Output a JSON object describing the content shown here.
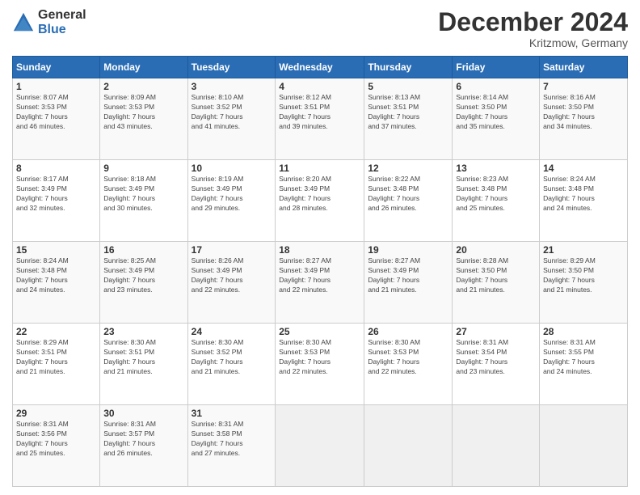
{
  "logo": {
    "general": "General",
    "blue": "Blue"
  },
  "header": {
    "title": "December 2024",
    "subtitle": "Kritzmow, Germany"
  },
  "days_of_week": [
    "Sunday",
    "Monday",
    "Tuesday",
    "Wednesday",
    "Thursday",
    "Friday",
    "Saturday"
  ],
  "weeks": [
    [
      {
        "day": "1",
        "sunrise": "8:07 AM",
        "sunset": "3:53 PM",
        "daylight": "7 hours and 46 minutes."
      },
      {
        "day": "2",
        "sunrise": "8:09 AM",
        "sunset": "3:53 PM",
        "daylight": "7 hours and 43 minutes."
      },
      {
        "day": "3",
        "sunrise": "8:10 AM",
        "sunset": "3:52 PM",
        "daylight": "7 hours and 41 minutes."
      },
      {
        "day": "4",
        "sunrise": "8:12 AM",
        "sunset": "3:51 PM",
        "daylight": "7 hours and 39 minutes."
      },
      {
        "day": "5",
        "sunrise": "8:13 AM",
        "sunset": "3:51 PM",
        "daylight": "7 hours and 37 minutes."
      },
      {
        "day": "6",
        "sunrise": "8:14 AM",
        "sunset": "3:50 PM",
        "daylight": "7 hours and 35 minutes."
      },
      {
        "day": "7",
        "sunrise": "8:16 AM",
        "sunset": "3:50 PM",
        "daylight": "7 hours and 34 minutes."
      }
    ],
    [
      {
        "day": "8",
        "sunrise": "8:17 AM",
        "sunset": "3:49 PM",
        "daylight": "7 hours and 32 minutes."
      },
      {
        "day": "9",
        "sunrise": "8:18 AM",
        "sunset": "3:49 PM",
        "daylight": "7 hours and 30 minutes."
      },
      {
        "day": "10",
        "sunrise": "8:19 AM",
        "sunset": "3:49 PM",
        "daylight": "7 hours and 29 minutes."
      },
      {
        "day": "11",
        "sunrise": "8:20 AM",
        "sunset": "3:49 PM",
        "daylight": "7 hours and 28 minutes."
      },
      {
        "day": "12",
        "sunrise": "8:22 AM",
        "sunset": "3:48 PM",
        "daylight": "7 hours and 26 minutes."
      },
      {
        "day": "13",
        "sunrise": "8:23 AM",
        "sunset": "3:48 PM",
        "daylight": "7 hours and 25 minutes."
      },
      {
        "day": "14",
        "sunrise": "8:24 AM",
        "sunset": "3:48 PM",
        "daylight": "7 hours and 24 minutes."
      }
    ],
    [
      {
        "day": "15",
        "sunrise": "8:24 AM",
        "sunset": "3:48 PM",
        "daylight": "7 hours and 24 minutes."
      },
      {
        "day": "16",
        "sunrise": "8:25 AM",
        "sunset": "3:49 PM",
        "daylight": "7 hours and 23 minutes."
      },
      {
        "day": "17",
        "sunrise": "8:26 AM",
        "sunset": "3:49 PM",
        "daylight": "7 hours and 22 minutes."
      },
      {
        "day": "18",
        "sunrise": "8:27 AM",
        "sunset": "3:49 PM",
        "daylight": "7 hours and 22 minutes."
      },
      {
        "day": "19",
        "sunrise": "8:27 AM",
        "sunset": "3:49 PM",
        "daylight": "7 hours and 21 minutes."
      },
      {
        "day": "20",
        "sunrise": "8:28 AM",
        "sunset": "3:50 PM",
        "daylight": "7 hours and 21 minutes."
      },
      {
        "day": "21",
        "sunrise": "8:29 AM",
        "sunset": "3:50 PM",
        "daylight": "7 hours and 21 minutes."
      }
    ],
    [
      {
        "day": "22",
        "sunrise": "8:29 AM",
        "sunset": "3:51 PM",
        "daylight": "7 hours and 21 minutes."
      },
      {
        "day": "23",
        "sunrise": "8:30 AM",
        "sunset": "3:51 PM",
        "daylight": "7 hours and 21 minutes."
      },
      {
        "day": "24",
        "sunrise": "8:30 AM",
        "sunset": "3:52 PM",
        "daylight": "7 hours and 21 minutes."
      },
      {
        "day": "25",
        "sunrise": "8:30 AM",
        "sunset": "3:53 PM",
        "daylight": "7 hours and 22 minutes."
      },
      {
        "day": "26",
        "sunrise": "8:30 AM",
        "sunset": "3:53 PM",
        "daylight": "7 hours and 22 minutes."
      },
      {
        "day": "27",
        "sunrise": "8:31 AM",
        "sunset": "3:54 PM",
        "daylight": "7 hours and 23 minutes."
      },
      {
        "day": "28",
        "sunrise": "8:31 AM",
        "sunset": "3:55 PM",
        "daylight": "7 hours and 24 minutes."
      }
    ],
    [
      {
        "day": "29",
        "sunrise": "8:31 AM",
        "sunset": "3:56 PM",
        "daylight": "7 hours and 25 minutes."
      },
      {
        "day": "30",
        "sunrise": "8:31 AM",
        "sunset": "3:57 PM",
        "daylight": "7 hours and 26 minutes."
      },
      {
        "day": "31",
        "sunrise": "8:31 AM",
        "sunset": "3:58 PM",
        "daylight": "7 hours and 27 minutes."
      },
      null,
      null,
      null,
      null
    ]
  ]
}
